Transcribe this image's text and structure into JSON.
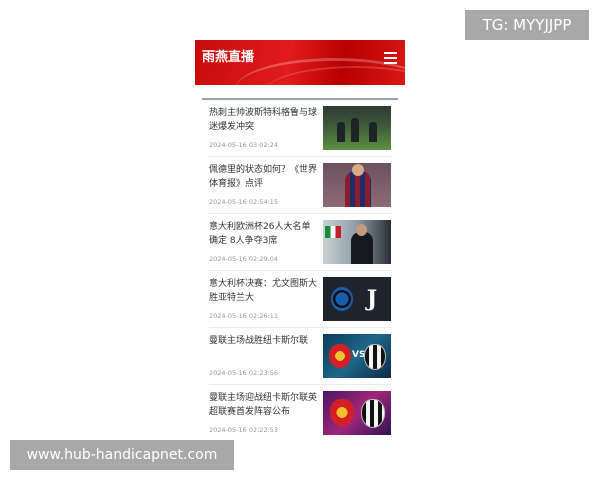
{
  "overlay": {
    "telegram": "TG: MYYJJPP",
    "website": "www.hub-handicapnet.com"
  },
  "header": {
    "title": "雨燕直播",
    "menu_icon": "hamburger-menu-icon",
    "accent_color": "#d71414"
  },
  "news": [
    {
      "title": "热刺主帅波斯特科格鲁与球迷爆发冲突",
      "time": "2024-05-16 03:02:24"
    },
    {
      "title": "佩德里的状态如何？《世界体育报》点评",
      "time": "2024-05-16 02:54:15"
    },
    {
      "title": "意大利欧洲杯26人大名单确定 8人争夺3席",
      "time": "2024-05-16 02:29:04"
    },
    {
      "title": "意大利杯决赛：尤文图斯大胜亚特兰大",
      "time": "2024-05-16 02:26:11"
    },
    {
      "title": "曼联主场战胜纽卡斯尔联",
      "time": "2024-05-16 02:23:56",
      "vs_label": "VS"
    },
    {
      "title": "曼联主场迎战纽卡斯尔联英超联赛首发阵容公布",
      "time": "2024-05-16 02:22:53"
    }
  ]
}
